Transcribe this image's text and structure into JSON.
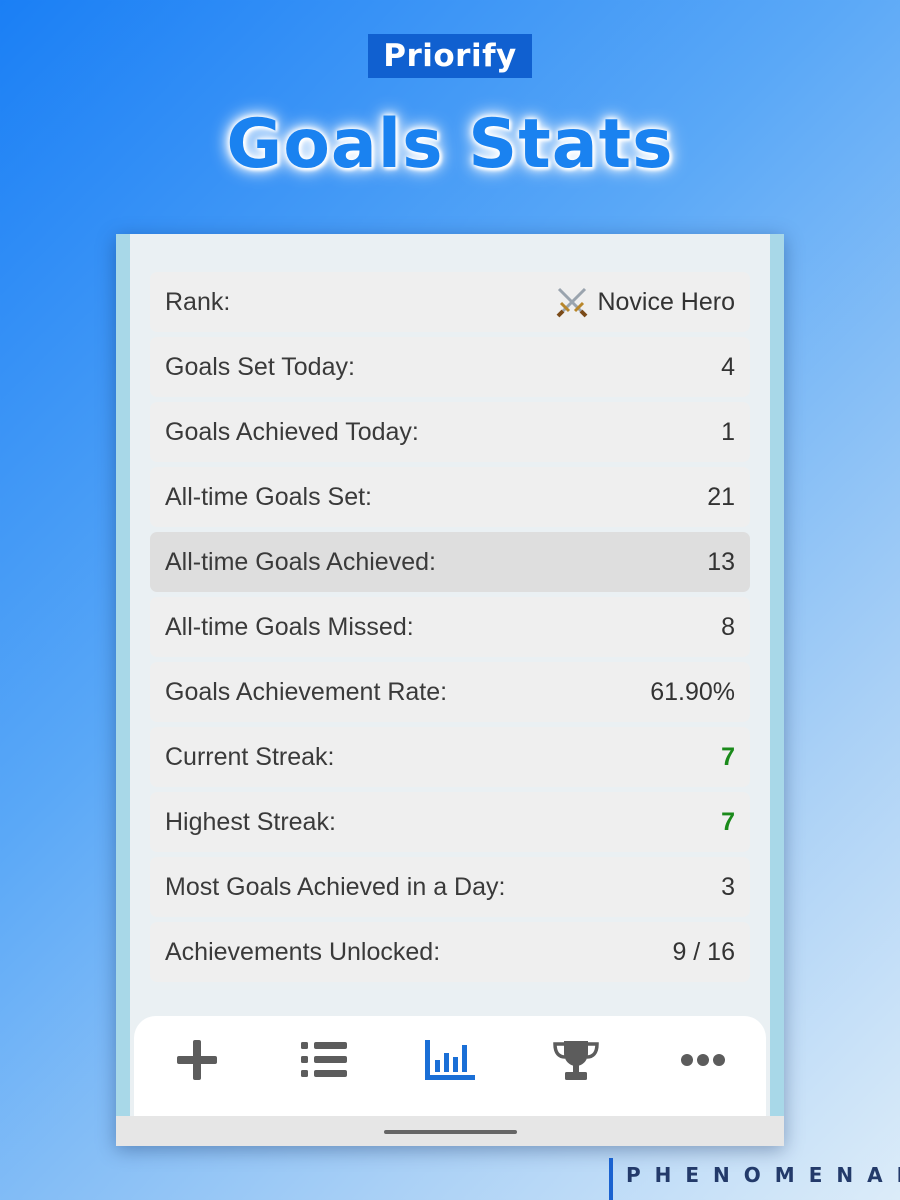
{
  "brand": "Priorify",
  "headline": "Goals Stats",
  "stats": [
    {
      "label": "Rank:",
      "value": "Novice Hero",
      "icon": "crossed-swords-icon"
    },
    {
      "label": "Goals Set Today:",
      "value": "4"
    },
    {
      "label": "Goals Achieved Today:",
      "value": "1"
    },
    {
      "label": "All-time Goals Set:",
      "value": "21"
    },
    {
      "label": "All-time Goals Achieved:",
      "value": "13",
      "highlighted": true
    },
    {
      "label": "All-time Goals Missed:",
      "value": "8"
    },
    {
      "label": "Goals Achievement Rate:",
      "value": "61.90%"
    },
    {
      "label": "Current Streak:",
      "value": "7",
      "color": "#1a8a1a"
    },
    {
      "label": "Highest Streak:",
      "value": "7",
      "color": "#1a8a1a"
    },
    {
      "label": "Most Goals Achieved in a Day:",
      "value": "3"
    },
    {
      "label": "Achievements Unlocked:",
      "value": "9 / 16"
    }
  ],
  "nav": [
    {
      "icon": "plus-icon",
      "active": false
    },
    {
      "icon": "list-icon",
      "active": false
    },
    {
      "icon": "bar-chart-icon",
      "active": true
    },
    {
      "icon": "trophy-icon",
      "active": false
    },
    {
      "icon": "more-icon",
      "active": false
    }
  ],
  "colors": {
    "accent": "#1a82f0",
    "active_nav": "#1a6fd6",
    "inactive_nav": "#5c5c5c",
    "streak_green": "#1a8a1a"
  },
  "footer_logo": "PHENOMENAL"
}
